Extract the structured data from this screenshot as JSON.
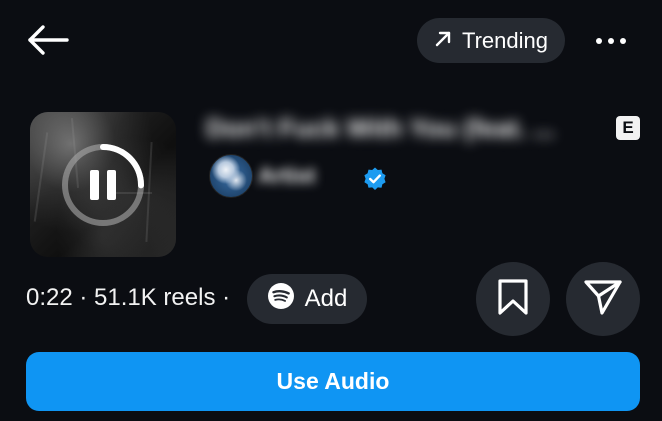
{
  "header": {
    "back_icon": "arrow-left-icon",
    "trending_label": "Trending",
    "trending_icon": "arrow-up-right-icon",
    "more_icon": "more-horizontal-icon"
  },
  "track": {
    "title": "Don't Fuck With You (feat. ...",
    "explicit_badge": "E",
    "artist": "Artist",
    "verified_icon": "verified-badge-icon",
    "playback_state_icon": "pause-icon"
  },
  "meta": {
    "text": "0:22 · 51.1K reels ·",
    "add_label": "Add",
    "add_icon": "spotify-icon"
  },
  "actions": {
    "save_icon": "bookmark-icon",
    "share_icon": "send-icon",
    "use_audio_label": "Use Audio"
  },
  "colors": {
    "background": "#0b0d12",
    "chip": "#262a31",
    "primary": "#0f95f3",
    "verified": "#1d9bf0"
  }
}
